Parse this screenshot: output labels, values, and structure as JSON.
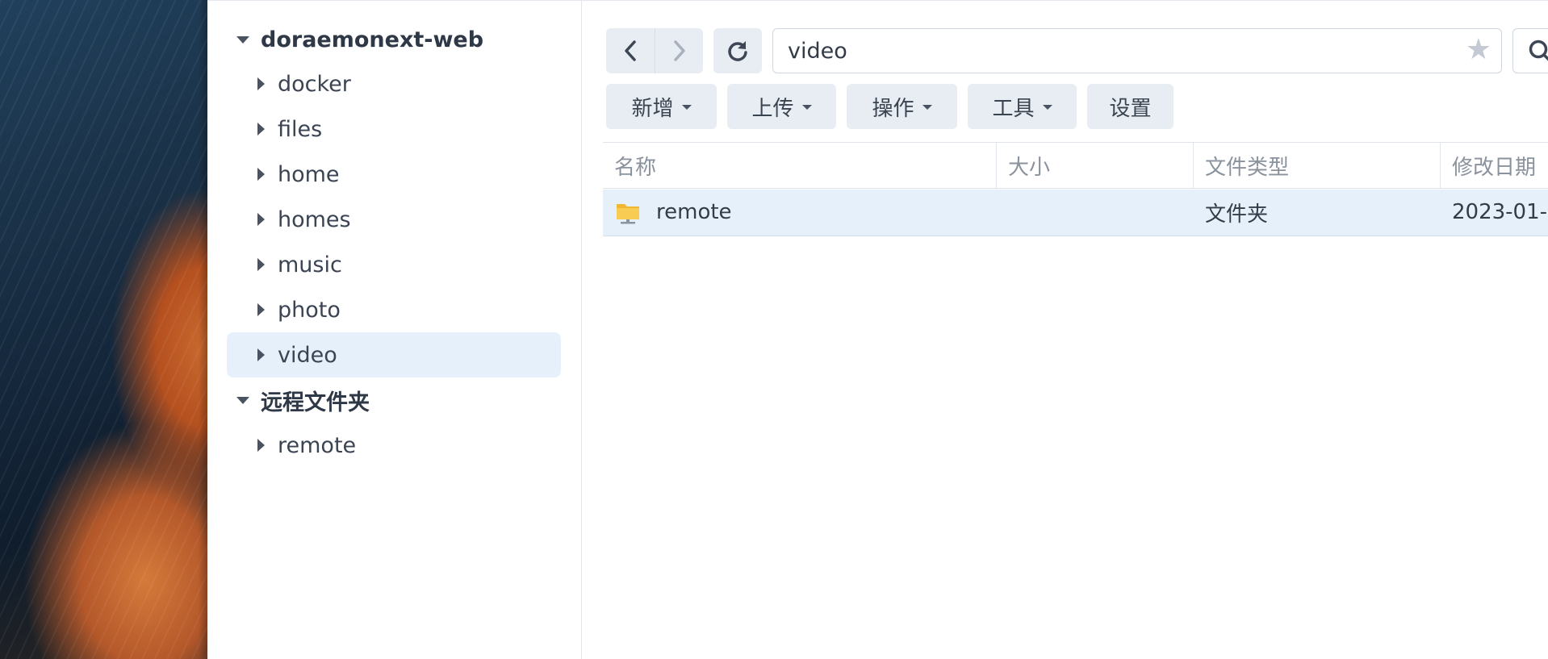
{
  "sidebar": {
    "root_label": "doraemonext-web",
    "shares": [
      {
        "label": "docker"
      },
      {
        "label": "files"
      },
      {
        "label": "home"
      },
      {
        "label": "homes"
      },
      {
        "label": "music"
      },
      {
        "label": "photo"
      },
      {
        "label": "video"
      }
    ],
    "remote_group_label": "远程文件夹",
    "remote_items": [
      {
        "label": "remote"
      }
    ]
  },
  "path": {
    "value": "video"
  },
  "toolbar": {
    "create_label": "新增",
    "upload_label": "上传",
    "action_label": "操作",
    "tools_label": "工具",
    "settings_label": "设置"
  },
  "file_list": {
    "columns": [
      "名称",
      "大小",
      "文件类型",
      "修改日期"
    ],
    "rows": [
      {
        "name": "remote",
        "size": "",
        "type": "文件夹",
        "modified": "2023-01-"
      }
    ]
  },
  "colors": {
    "selected_row": "#e6f0fb",
    "button_bg": "#e8edf3",
    "folder": "#f5c342"
  }
}
